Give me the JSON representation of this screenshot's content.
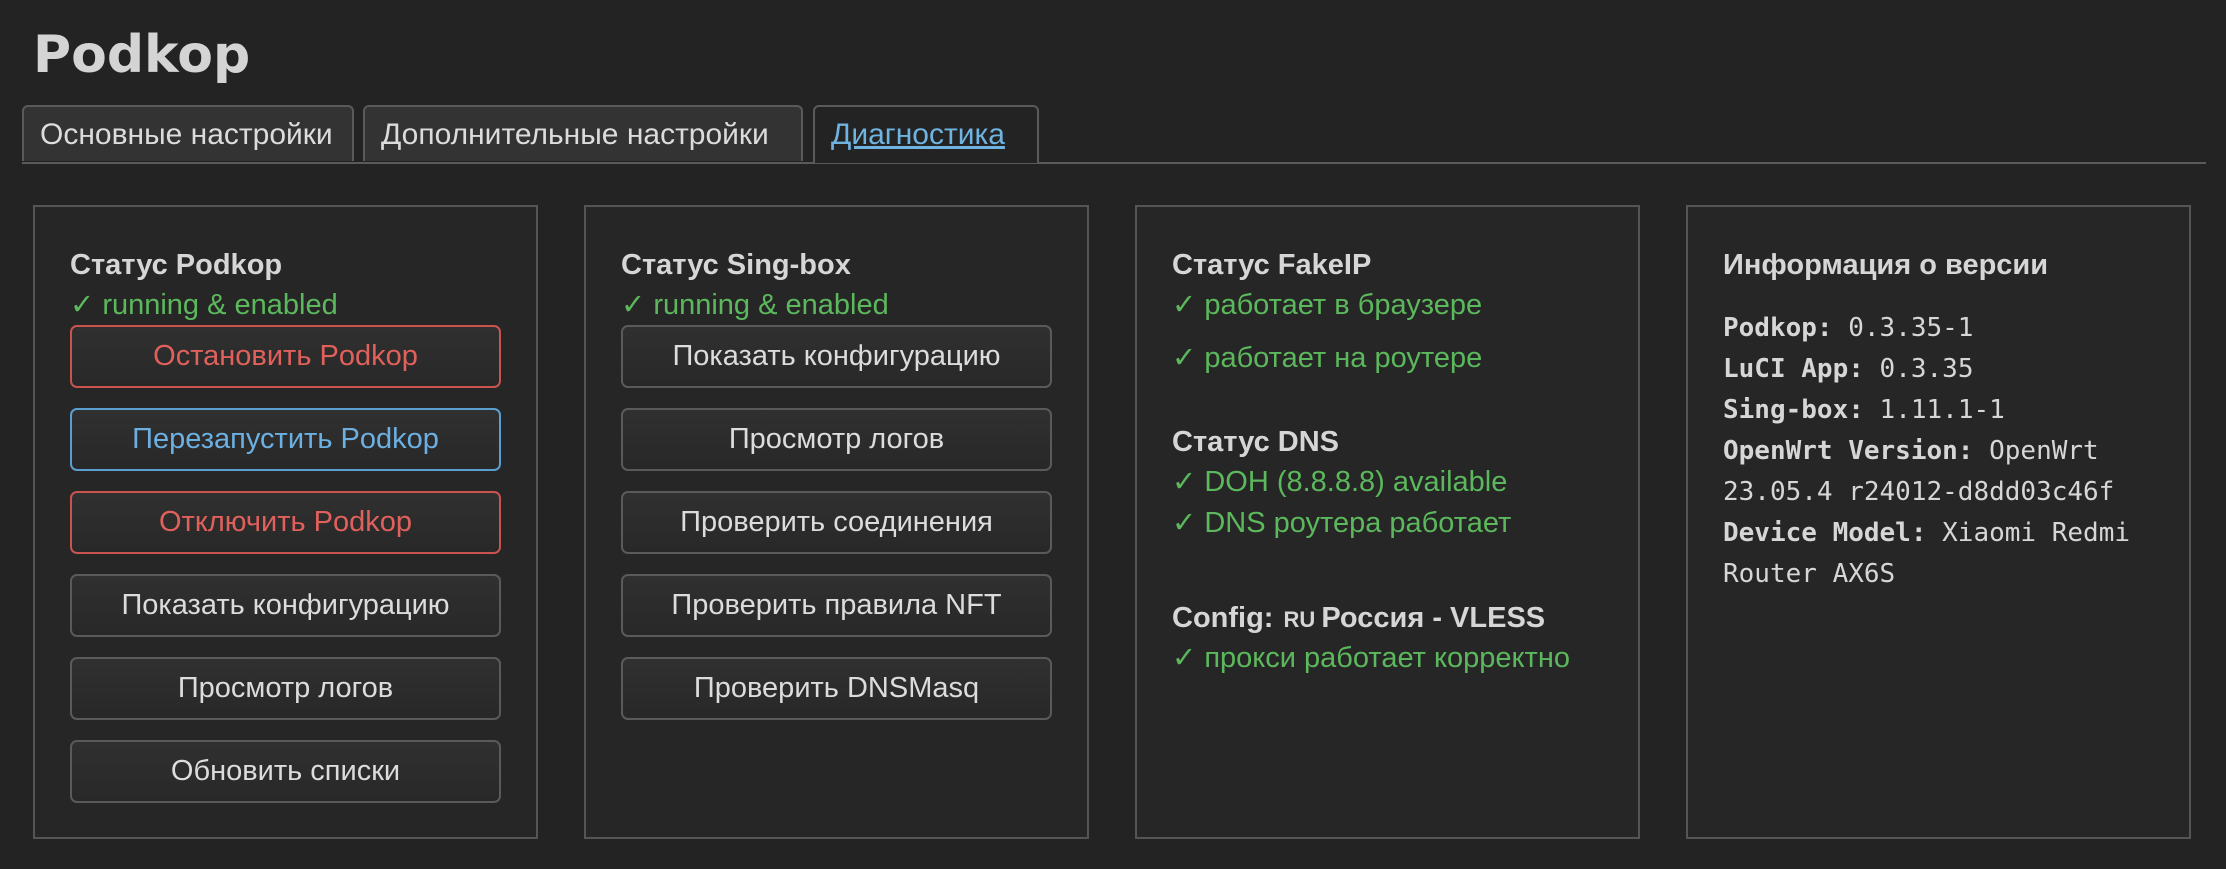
{
  "app": {
    "title": "Podkop"
  },
  "tabs": [
    {
      "label": "Основные настройки"
    },
    {
      "label": "Дополнительные настройки"
    },
    {
      "label": "Диагностика"
    }
  ],
  "podkop_panel": {
    "title": "Статус Podkop",
    "status": "running & enabled",
    "buttons": {
      "stop": "Остановить Podkop",
      "restart": "Перезапустить Podkop",
      "disable": "Отключить Podkop",
      "show_config": "Показать конфигурацию",
      "view_logs": "Просмотр логов",
      "update_lists": "Обновить списки"
    }
  },
  "singbox_panel": {
    "title": "Статус Sing-box",
    "status": "running & enabled",
    "buttons": {
      "show_config": "Показать конфигурацию",
      "view_logs": "Просмотр логов",
      "check_connections": "Проверить соединения",
      "check_nft": "Проверить правила NFT",
      "check_dnsmasq": "Проверить DNSMasq"
    }
  },
  "fakeip_panel": {
    "fakeip_title": "Статус FakeIP",
    "fakeip_browser": "работает в браузере",
    "fakeip_router": "работает на роутере",
    "dns_title": "Статус DNS",
    "dns_doh": "DOH (8.8.8.8) available",
    "dns_router": "DNS роутера работает",
    "config_label": "Config:",
    "config_flag": "RU",
    "config_name": "Россия - VLESS",
    "config_status": "прокси работает корректно"
  },
  "version_panel": {
    "title": "Информация о версии",
    "podkop_key": "Podkop:",
    "podkop_val": "0.3.35-1",
    "luci_key": "LuCI App:",
    "luci_val": "0.3.35",
    "singbox_key": "Sing-box:",
    "singbox_val": "1.11.1-1",
    "openwrt_key": "OpenWrt Version:",
    "openwrt_val_1": "OpenWrt",
    "openwrt_val_2": "23.05.4 r24012-d8dd03c46f",
    "device_key": "Device Model:",
    "device_val_1": "Xiaomi Redmi",
    "device_val_2": "Router AX6S"
  },
  "symbols": {
    "check": "✓"
  },
  "colors": {
    "background": "#232323",
    "ok_green": "#5cb85c",
    "danger_red": "#e0605b",
    "info_blue": "#6cb0e2",
    "active_tab": "#6fb3e0"
  }
}
